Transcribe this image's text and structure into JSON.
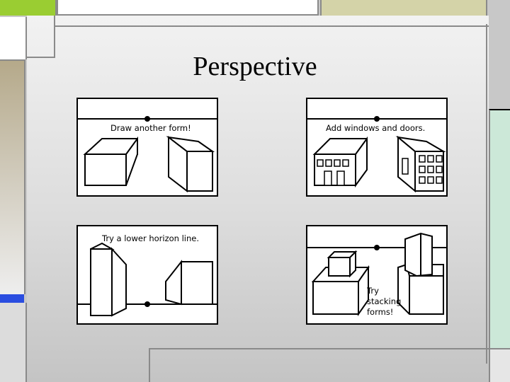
{
  "slide": {
    "title": "Perspective",
    "colors": {
      "accent_green": "#9acd32",
      "accent_tan": "#b5a98a",
      "accent_khaki": "#d4d3a8",
      "accent_blue": "#2a4de0",
      "mint": "#cce8d8"
    }
  },
  "panels": [
    {
      "caption": "Draw another form!"
    },
    {
      "caption": "Add windows and doors."
    },
    {
      "caption": "Try a lower horizon line."
    },
    {
      "caption_lines": [
        "Try",
        "stacking",
        "forms!"
      ]
    }
  ]
}
